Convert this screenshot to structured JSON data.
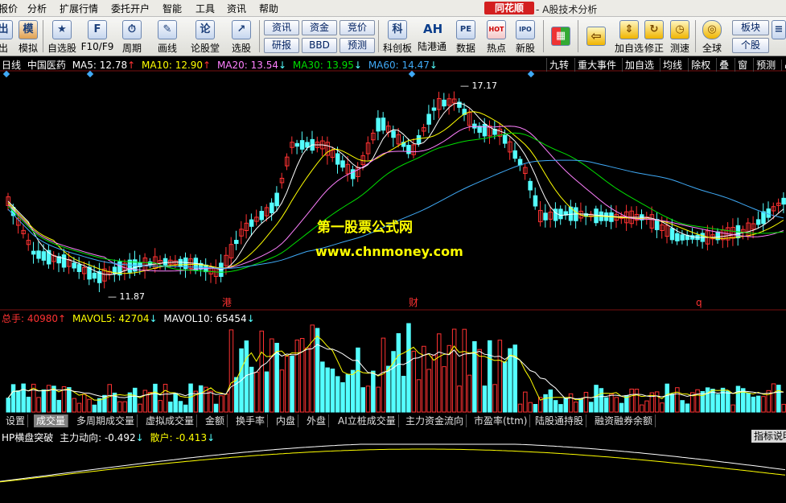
{
  "menu": {
    "items": [
      "报价",
      "分析",
      "扩展行情",
      "委托开户",
      "智能",
      "工具",
      "资讯",
      "帮助"
    ],
    "brand": "同花顺",
    "brand_sub": "- A股技术分析"
  },
  "toolbar": {
    "buttons": [
      {
        "label": "出",
        "icon": "出"
      },
      {
        "label": "模拟",
        "icon": "模"
      },
      {
        "label": "自选股",
        "icon": "★"
      },
      {
        "label": "F10/F9",
        "icon": "F"
      },
      {
        "label": "周期",
        "icon": "⏱"
      },
      {
        "label": "画线",
        "icon": "✎"
      },
      {
        "label": "论股堂",
        "icon": "论"
      },
      {
        "label": "选股",
        "icon": "↗"
      }
    ],
    "small_buttons": [
      "资讯",
      "资金",
      "竞价",
      "研报",
      "BBD",
      "预测"
    ],
    "buttons2": [
      {
        "label": "科创板",
        "icon": "科"
      },
      {
        "label": "陆港通",
        "icon": "AH"
      },
      {
        "label": "数据",
        "icon": "PE"
      },
      {
        "label": "热点",
        "icon": "HOT"
      },
      {
        "label": "新股",
        "icon": "IPO"
      }
    ],
    "buttons3": [
      {
        "label": "",
        "icon": "▦"
      },
      {
        "label": "",
        "icon": "⇦"
      },
      {
        "label": "加自选",
        "icon": "⇕"
      },
      {
        "label": "修正",
        "icon": "↻"
      },
      {
        "label": "测速",
        "icon": "◷"
      },
      {
        "label": "全球",
        "icon": "◎"
      }
    ],
    "right_small": [
      "板块",
      "个股"
    ]
  },
  "kline_info": {
    "period": "日线",
    "stock": "中国医药",
    "ma5": "MA5: 12.78",
    "ma10": "MA10: 12.90",
    "ma20": "MA20: 13.54",
    "ma30": "MA30: 13.95",
    "ma60": "MA60: 14.47",
    "right_tabs": [
      "九转",
      "重大事件",
      "加自选",
      "均线",
      "除权",
      "叠",
      "窗",
      "预测"
    ],
    "high_label": "17.17",
    "low_label": "11.87",
    "markers": [
      "港",
      "财",
      "q"
    ]
  },
  "volume_info": {
    "total": "总手: 40980",
    "mavol5": "MAVOL5: 42704",
    "mavol10": "MAVOL10: 65454"
  },
  "watermark": {
    "line1": "第一股票公式网",
    "line2": "www.chnmoney.com"
  },
  "bottom_tabs": [
    "设置",
    "成交量",
    "多周期成交量",
    "虚拟成交量",
    "金额",
    "换手率",
    "内盘",
    "外盘",
    "AI立桩成交量",
    "主力资金流向",
    "市盈率(ttm)",
    "陆股通持股",
    "融资融券余额"
  ],
  "indicator_info": {
    "name": "HP横盘突破",
    "main": "主力动向: -0.492",
    "retail": "散户: -0.413",
    "button": "指标说明"
  },
  "colors": {
    "up": "#ff3232",
    "down": "#54ffff",
    "ma5": "#ffffff",
    "ma10": "#ffff00",
    "ma20": "#ff80ff",
    "ma30": "#00e000",
    "ma60": "#3fa9f5"
  }
}
